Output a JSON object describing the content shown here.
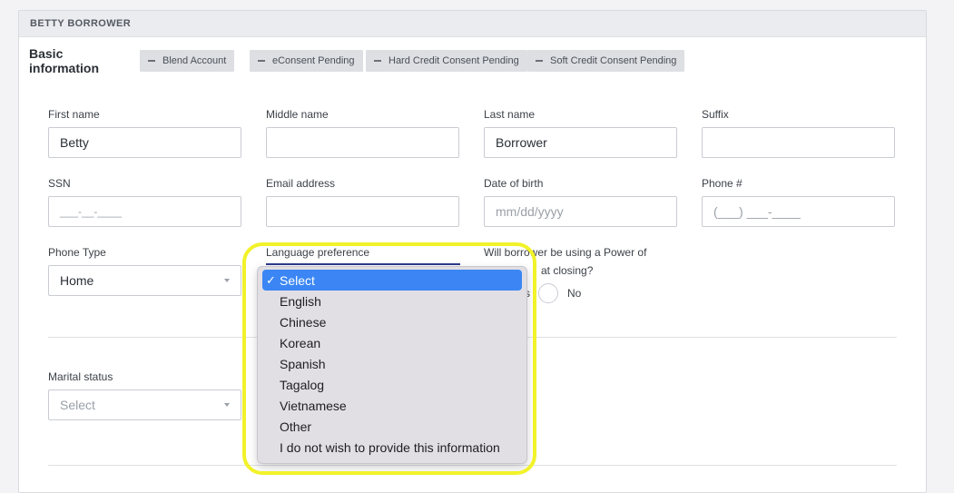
{
  "card": {
    "title": "BETTY BORROWER"
  },
  "section": {
    "title": "Basic information",
    "badges": [
      {
        "label": "Blend Account"
      },
      {
        "label": "eConsent Pending"
      },
      {
        "label": "Hard Credit Consent Pending"
      },
      {
        "label": "Soft Credit Consent Pending"
      }
    ]
  },
  "fields": {
    "first_name": {
      "label": "First name",
      "value": "Betty"
    },
    "middle_name": {
      "label": "Middle name",
      "value": ""
    },
    "last_name": {
      "label": "Last name",
      "value": "Borrower"
    },
    "suffix": {
      "label": "Suffix",
      "value": ""
    },
    "ssn": {
      "label": "SSN",
      "placeholder": "___-__-____"
    },
    "email": {
      "label": "Email address",
      "value": ""
    },
    "dob": {
      "label": "Date of birth",
      "placeholder": "mm/dd/yyyy"
    },
    "phone": {
      "label": "Phone #",
      "placeholder": "(___) ___-____"
    },
    "phone_type": {
      "label": "Phone Type",
      "value": "Home"
    },
    "language": {
      "label": "Language preference"
    },
    "poa": {
      "label_line1": "Will borrower be using a Power of",
      "label_line2": "at closing?",
      "yes_fragment": "s",
      "no_label": "No"
    },
    "marital_status": {
      "label": "Marital status",
      "placeholder": "Select"
    }
  },
  "language_dropdown": {
    "check": "✓",
    "options": [
      {
        "label": "Select",
        "selected": true
      },
      {
        "label": "English"
      },
      {
        "label": "Chinese"
      },
      {
        "label": "Korean"
      },
      {
        "label": "Spanish"
      },
      {
        "label": "Tagalog"
      },
      {
        "label": "Vietnamese"
      },
      {
        "label": "Other"
      },
      {
        "label": "I do not wish to provide this information"
      }
    ]
  },
  "colors": {
    "highlight": "#f2f22a",
    "selected_option": "#3b86f4",
    "accent_underline": "#2d3a8c"
  }
}
